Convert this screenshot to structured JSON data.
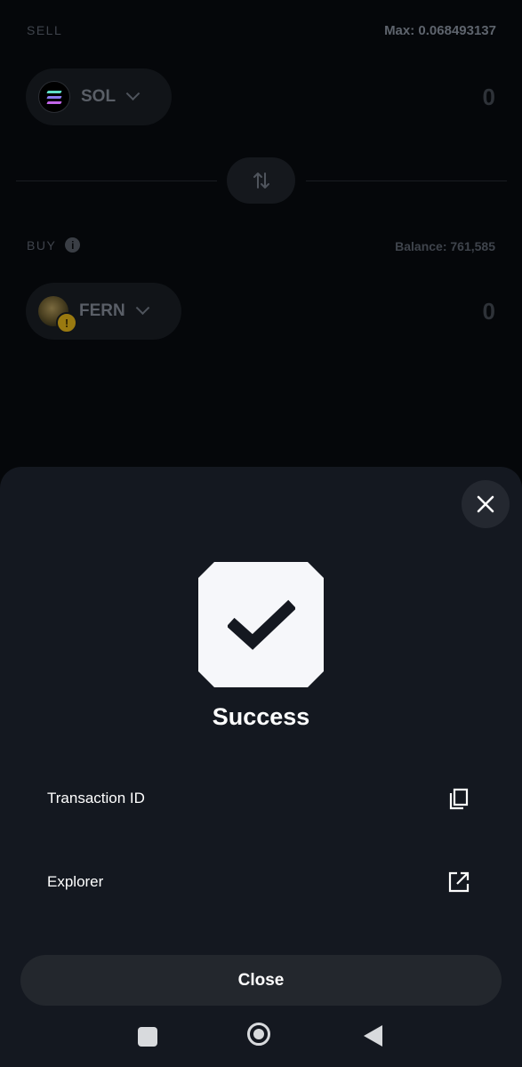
{
  "swap_form": {
    "sell": {
      "label": "SELL",
      "max_text": "Max: 0.068493137",
      "token": {
        "symbol": "SOL",
        "icon": "solana-logo-icon"
      },
      "amount": "0"
    },
    "swap_direction_icon": "swap-arrows-icon",
    "buy": {
      "label": "BUY",
      "info_icon": "info-icon",
      "balance_text": "Balance: 761,585",
      "token": {
        "symbol": "FERN",
        "icon": "fern-token-logo",
        "warning_icon": "!"
      },
      "amount": "0"
    }
  },
  "success_sheet": {
    "close_icon": "close-icon",
    "status_icon": "checkmark-icon",
    "title": "Success",
    "rows": [
      {
        "label": "Transaction ID",
        "icon": "copy-icon"
      },
      {
        "label": "Explorer",
        "icon": "external-link-icon"
      }
    ],
    "close_button_label": "Close"
  },
  "system_nav": {
    "items": [
      "recent-apps-icon",
      "home-icon",
      "back-icon"
    ]
  },
  "colors": {
    "background": "#05070a",
    "sheet": "#141820",
    "badge": "#f6f7fa",
    "warning": "#9a7a10"
  }
}
